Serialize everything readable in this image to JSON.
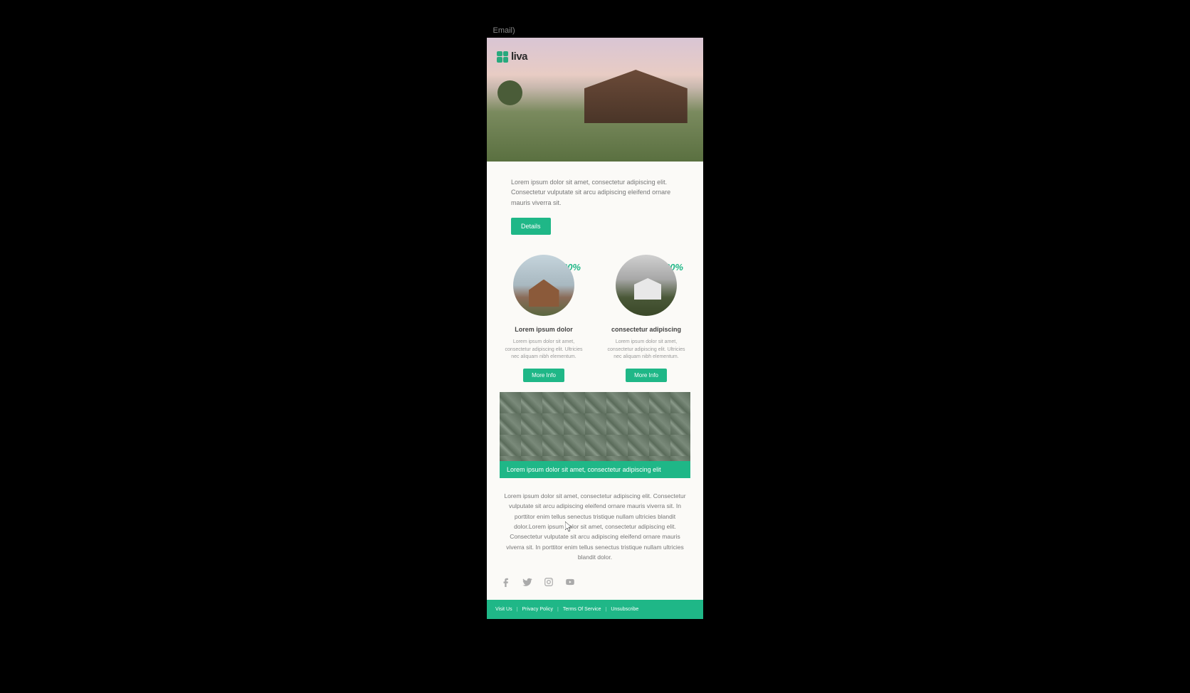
{
  "context_label": "Email)",
  "brand": {
    "name": "liva"
  },
  "intro": "Lorem ipsum dolor sit amet, consectetur adipiscing elit. Consectetur vulputate sit arcu adipiscing eleifend ornare mauris viverra sit.",
  "details_button": "Details",
  "offers": [
    {
      "discount": "-30%",
      "title": "Lorem ipsum dolor",
      "desc": "Lorem ipsum dolor sit amet, consectetur adipiscing elit. Ultricies nec aliquam nibh elementum.",
      "cta": "More Info"
    },
    {
      "discount": "-20%",
      "title": "consectetur adipiscing",
      "desc": "Lorem ipsum dolor sit amet, consectetur adipiscing elit. Ultricies nec aliquam nibh elementum.",
      "cta": "More Info"
    }
  ],
  "map_caption": "Lorem ipsum dolor sit amet, consectetur adipiscing elit",
  "body_text": "Lorem ipsum dolor sit amet, consectetur adipiscing elit. Consectetur vulputate sit arcu adipiscing eleifend ornare mauris viverra sit. In porttitor enim tellus senectus tristique nullam ultricies blandit dolor.Lorem ipsum dolor sit amet, consectetur adipiscing elit. Consectetur vulputate sit arcu adipiscing eleifend ornare mauris viverra sit. In porttitor enim tellus senectus tristique nullam ultricies blandit dolor.",
  "footer_links": [
    "Visit Us",
    "Privacy Policy",
    "Terms Of Service",
    "Unsubscribe"
  ]
}
